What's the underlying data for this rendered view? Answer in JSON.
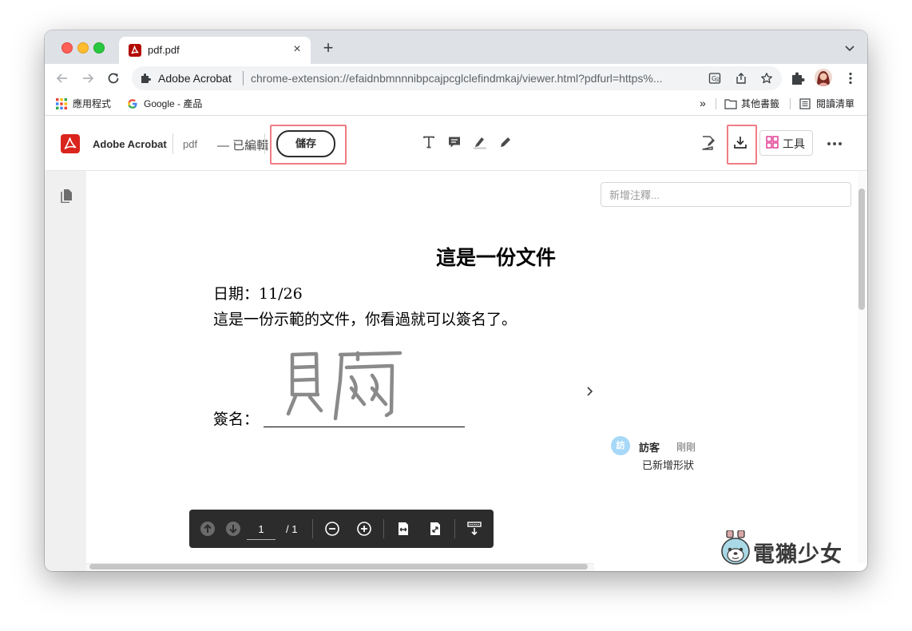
{
  "browser": {
    "tab": {
      "title": "pdf.pdf",
      "close_glyph": "×"
    },
    "new_tab_glyph": "+",
    "omnibox": {
      "site_name": "Adobe Acrobat",
      "url": "chrome-extension://efaidnbmnnnibpcajpcglclefindmkaj/viewer.html?pdfurl=https%..."
    },
    "bookmarks": {
      "apps_label": "應用程式",
      "google_label": "Google - 產品",
      "overflow_glyph": "»",
      "other_label": "其他書籤",
      "reading_list_label": "閱讀清單"
    }
  },
  "acrobat": {
    "app_name": "Adobe Acrobat",
    "file_label": "pdf",
    "edit_status": "— 已編輯",
    "save_label": "儲存",
    "tools_label": "工具",
    "highlight_color": "#f07c84"
  },
  "document": {
    "title": "這是一份文件",
    "date_line": "日期：11/26",
    "body_line": "這是一份示範的文件，你看過就可以簽名了。",
    "signature_label": "簽名："
  },
  "page_nav": {
    "current_page": "1",
    "total_pages": "/ 1"
  },
  "comments": {
    "input_placeholder": "新增注釋...",
    "items": [
      {
        "avatar_text": "訪",
        "author": "訪客",
        "time": "剛剛",
        "text": "已新增形狀"
      }
    ]
  },
  "watermark": {
    "text": "電獺少女"
  }
}
